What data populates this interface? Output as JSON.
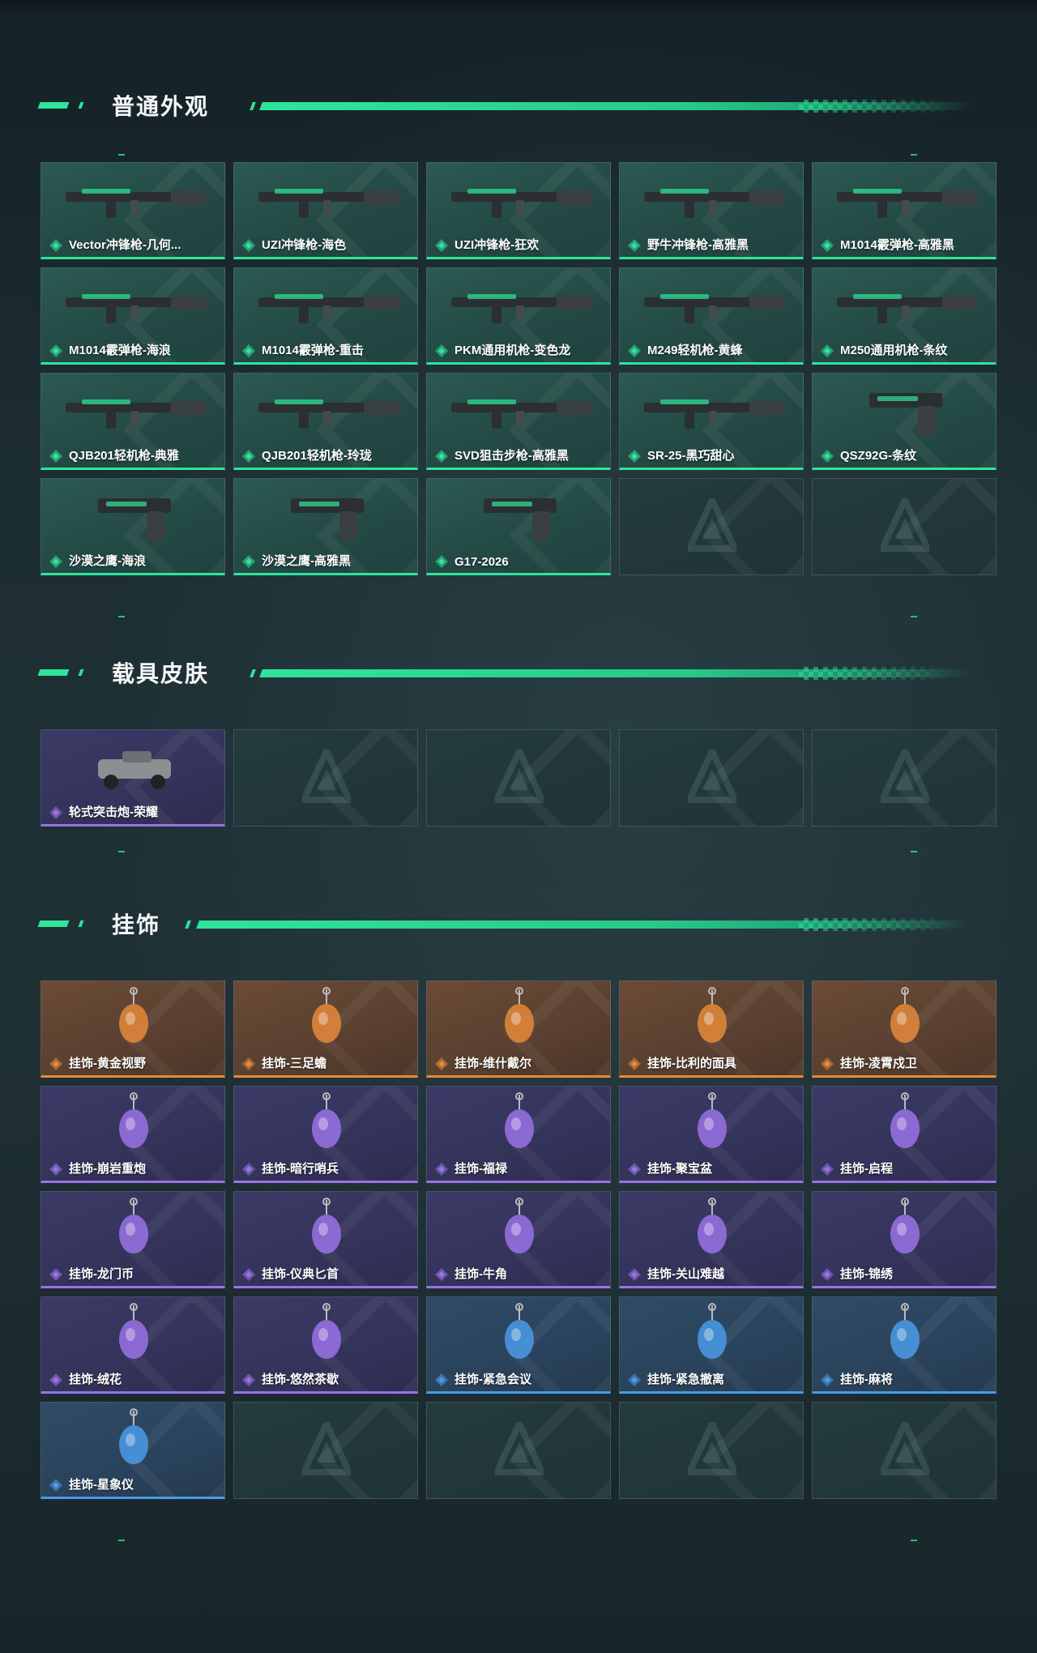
{
  "colors": {
    "accent": "#2ee59a",
    "rarity_green": "#2ee59a",
    "rarity_purple": "#9a72e6",
    "rarity_orange": "#e58a3a",
    "rarity_blue": "#4a9be8"
  },
  "sections": [
    {
      "title": "普通外观",
      "items": [
        {
          "label": "Vector冲锋枪-几何...",
          "rarity": "green",
          "icon": "smg-icon"
        },
        {
          "label": "UZI冲锋枪-海色",
          "rarity": "green",
          "icon": "smg-icon"
        },
        {
          "label": "UZI冲锋枪-狂欢",
          "rarity": "green",
          "icon": "smg-icon"
        },
        {
          "label": "野牛冲锋枪-高雅黑",
          "rarity": "green",
          "icon": "smg-icon"
        },
        {
          "label": "M1014霰弹枪-高雅黑",
          "rarity": "green",
          "icon": "shotgun-icon"
        },
        {
          "label": "M1014霰弹枪-海浪",
          "rarity": "green",
          "icon": "shotgun-icon"
        },
        {
          "label": "M1014霰弹枪-重击",
          "rarity": "green",
          "icon": "shotgun-icon"
        },
        {
          "label": "PKM通用机枪-变色龙",
          "rarity": "green",
          "icon": "machine-gun-icon"
        },
        {
          "label": "M249轻机枪-黄蜂",
          "rarity": "green",
          "icon": "machine-gun-icon"
        },
        {
          "label": "M250通用机枪-条纹",
          "rarity": "green",
          "icon": "machine-gun-icon"
        },
        {
          "label": "QJB201轻机枪-典雅",
          "rarity": "green",
          "icon": "rifle-icon"
        },
        {
          "label": "QJB201轻机枪-玲珑",
          "rarity": "green",
          "icon": "rifle-icon"
        },
        {
          "label": "SVD狙击步枪-高雅黑",
          "rarity": "green",
          "icon": "sniper-icon"
        },
        {
          "label": "SR-25-黑巧甜心",
          "rarity": "green",
          "icon": "rifle-icon"
        },
        {
          "label": "QSZ92G-条纹",
          "rarity": "green",
          "icon": "pistol-icon"
        },
        {
          "label": "沙漠之鹰-海浪",
          "rarity": "green",
          "icon": "pistol-icon"
        },
        {
          "label": "沙漠之鹰-高雅黑",
          "rarity": "green",
          "icon": "pistol-icon"
        },
        {
          "label": "G17-2026",
          "rarity": "green",
          "icon": "pistol-icon"
        },
        {
          "label": "",
          "rarity": "empty",
          "icon": "empty-slot-logo-icon"
        },
        {
          "label": "",
          "rarity": "empty",
          "icon": "empty-slot-logo-icon"
        }
      ]
    },
    {
      "title": "载具皮肤",
      "items": [
        {
          "label": "轮式突击炮-荣耀",
          "rarity": "purple",
          "icon": "vehicle-icon"
        },
        {
          "label": "",
          "rarity": "empty",
          "icon": "empty-slot-logo-icon"
        },
        {
          "label": "",
          "rarity": "empty",
          "icon": "empty-slot-logo-icon"
        },
        {
          "label": "",
          "rarity": "empty",
          "icon": "empty-slot-logo-icon"
        },
        {
          "label": "",
          "rarity": "empty",
          "icon": "empty-slot-logo-icon"
        }
      ]
    },
    {
      "title": "挂饰",
      "items": [
        {
          "label": "挂饰-黄金视野",
          "rarity": "orange",
          "icon": "charm-icon"
        },
        {
          "label": "挂饰-三足蟾",
          "rarity": "orange",
          "icon": "charm-icon"
        },
        {
          "label": "挂饰-维什戴尔",
          "rarity": "orange",
          "icon": "charm-icon"
        },
        {
          "label": "挂饰-比利的面具",
          "rarity": "orange",
          "icon": "charm-icon"
        },
        {
          "label": "挂饰-凌霄戍卫",
          "rarity": "orange",
          "icon": "charm-icon"
        },
        {
          "label": "挂饰-崩岩重炮",
          "rarity": "purple",
          "icon": "charm-icon"
        },
        {
          "label": "挂饰-暗行哨兵",
          "rarity": "purple",
          "icon": "charm-icon"
        },
        {
          "label": "挂饰-福禄",
          "rarity": "purple",
          "icon": "charm-icon"
        },
        {
          "label": "挂饰-聚宝盆",
          "rarity": "purple",
          "icon": "charm-icon"
        },
        {
          "label": "挂饰-启程",
          "rarity": "purple",
          "icon": "charm-icon"
        },
        {
          "label": "挂饰-龙门币",
          "rarity": "purple",
          "icon": "charm-icon"
        },
        {
          "label": "挂饰-仪典匕首",
          "rarity": "purple",
          "icon": "charm-icon"
        },
        {
          "label": "挂饰-牛角",
          "rarity": "purple",
          "icon": "charm-icon"
        },
        {
          "label": "挂饰-关山难越",
          "rarity": "purple",
          "icon": "charm-icon"
        },
        {
          "label": "挂饰-锦绣",
          "rarity": "purple",
          "icon": "charm-icon"
        },
        {
          "label": "挂饰-绒花",
          "rarity": "purple",
          "icon": "charm-icon"
        },
        {
          "label": "挂饰-悠然茶歇",
          "rarity": "purple",
          "icon": "charm-icon"
        },
        {
          "label": "挂饰-紧急会议",
          "rarity": "blue",
          "icon": "charm-icon"
        },
        {
          "label": "挂饰-紧急撤离",
          "rarity": "blue",
          "icon": "charm-icon"
        },
        {
          "label": "挂饰-麻将",
          "rarity": "blue",
          "icon": "charm-icon"
        },
        {
          "label": "挂饰-星象仪",
          "rarity": "blue",
          "icon": "charm-icon"
        },
        {
          "label": "",
          "rarity": "empty",
          "icon": "empty-slot-logo-icon"
        },
        {
          "label": "",
          "rarity": "empty",
          "icon": "empty-slot-logo-icon"
        },
        {
          "label": "",
          "rarity": "empty",
          "icon": "empty-slot-logo-icon"
        },
        {
          "label": "",
          "rarity": "empty",
          "icon": "empty-slot-logo-icon"
        }
      ]
    }
  ]
}
